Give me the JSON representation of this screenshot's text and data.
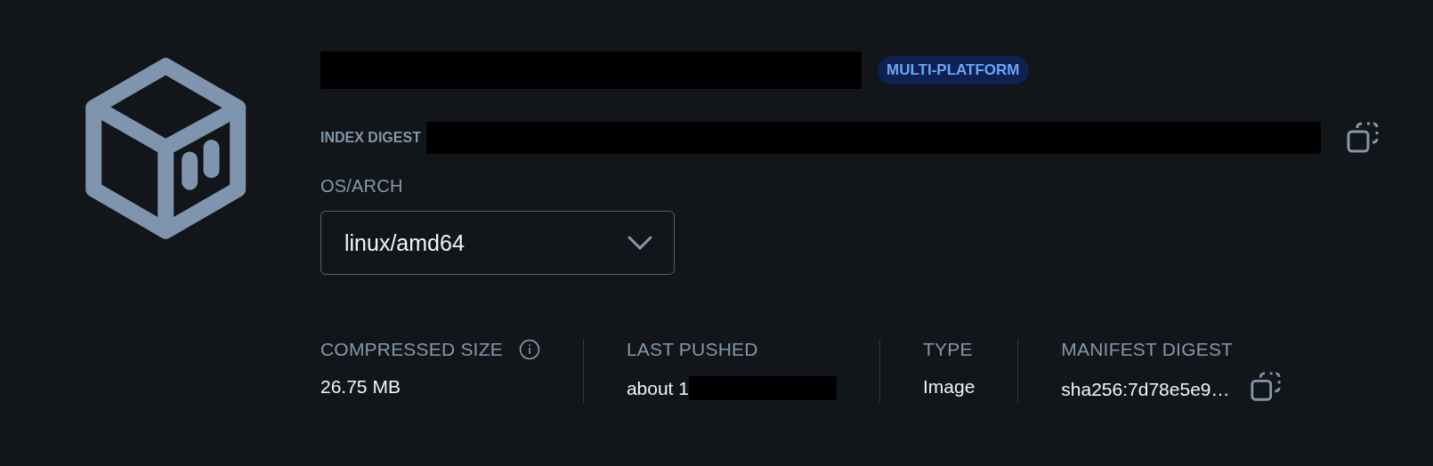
{
  "header": {
    "badge": "MULTI-PLATFORM"
  },
  "index_digest": {
    "label": "INDEX DIGEST"
  },
  "os_arch": {
    "label": "OS/ARCH",
    "value": "linux/amd64"
  },
  "stats": [
    {
      "label": "COMPRESSED SIZE",
      "value": "26.75 MB",
      "info": true,
      "redacted": false,
      "copy": false
    },
    {
      "label": "LAST PUSHED",
      "value": "about 1",
      "info": false,
      "redacted": true,
      "copy": false
    },
    {
      "label": "TYPE",
      "value": "Image",
      "info": false,
      "redacted": false,
      "copy": false
    },
    {
      "label": "MANIFEST DIGEST",
      "value": "sha256:7d78e5e9…",
      "info": false,
      "redacted": false,
      "copy": true
    }
  ]
}
